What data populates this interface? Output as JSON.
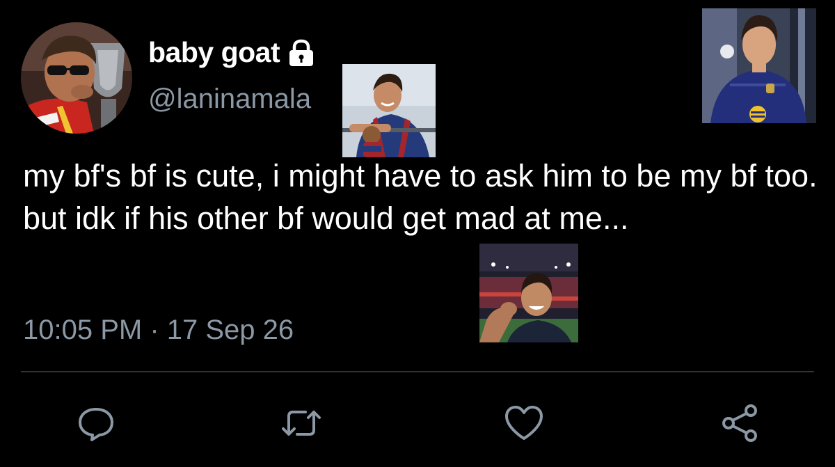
{
  "author": {
    "display_name": "baby goat",
    "handle": "@laninamala",
    "protected_icon": "lock-icon",
    "avatar_alt": "profile photo"
  },
  "tweet": {
    "text": "my bf's bf is cute, i might have to ask him to be my bf too. but idk if his other bf would get mad at me...",
    "timestamp": "10:05 PM · 17 Sep 26"
  },
  "stickers": [
    {
      "name": "photo-sticker-young-man-with-plush-toy"
    },
    {
      "name": "photo-sticker-young-man-in-blue-jersey"
    },
    {
      "name": "photo-sticker-young-man-in-stadium"
    }
  ],
  "actions": [
    {
      "icon": "reply-icon"
    },
    {
      "icon": "retweet-icon"
    },
    {
      "icon": "like-icon"
    },
    {
      "icon": "share-icon"
    }
  ],
  "colors": {
    "background": "#000000",
    "primary_text": "#ffffff",
    "secondary_text": "#8b98a5",
    "icon": "#8b98a5",
    "divider": "#2f3336"
  }
}
